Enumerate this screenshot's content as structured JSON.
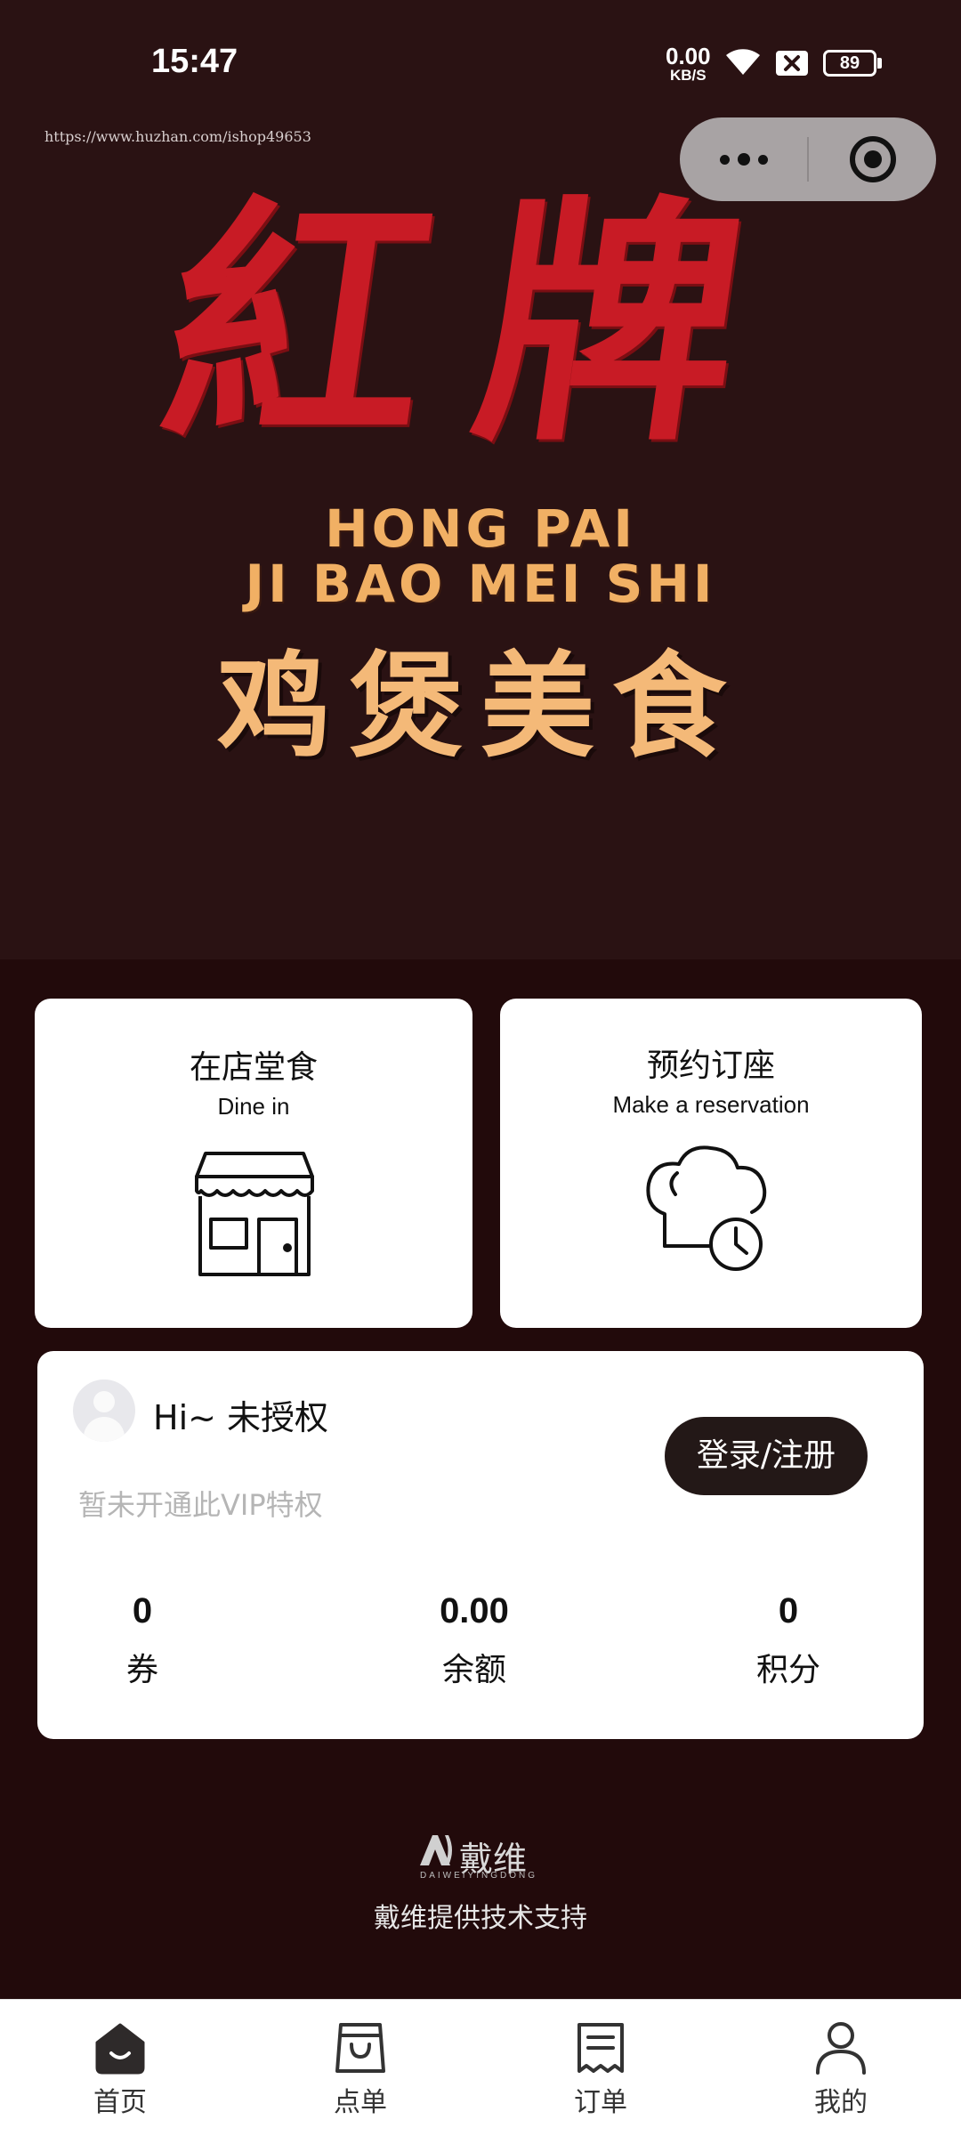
{
  "status_bar": {
    "time": "15:47",
    "net_speed_value": "0.00",
    "net_speed_unit": "KB/S",
    "battery": "89",
    "icons": [
      "wifi-icon",
      "sim-x-icon",
      "battery-icon"
    ]
  },
  "banner": {
    "url": "https://www.huzhan.com/ishop49653",
    "brand_cn": "紅牌",
    "brand_en_line1": "HONG PAI",
    "brand_en_line2": "JI BAO MEI SHI",
    "brand_sub": "鸡煲美食",
    "colors": {
      "brand_red": "#c81b25",
      "brand_gold": "#f1b064"
    }
  },
  "capsule": {
    "icons": [
      "more-icon",
      "close-miniprogram-icon"
    ]
  },
  "cards": {
    "dine_in": {
      "title": "在店堂食",
      "subtitle": "Dine in",
      "icon": "storefront-icon"
    },
    "reserve": {
      "title": "预约订座",
      "subtitle": "Make a reservation",
      "icon": "chef-hat-clock-icon"
    }
  },
  "member": {
    "greeting": "Hi~ 未授权",
    "login_button": "登录/注册",
    "vip_note": "暂未开通此VIP特权",
    "stats": [
      {
        "value": "0",
        "label": "券"
      },
      {
        "value": "0.00",
        "label": "余额"
      },
      {
        "value": "0",
        "label": "积分"
      }
    ]
  },
  "credit": {
    "logo_name": "戴维",
    "logo_en": "DAIWEIYINGDONG",
    "text": "戴维提供技术支持"
  },
  "tabbar": [
    {
      "label": "首页",
      "icon": "home-icon",
      "active": true
    },
    {
      "label": "点单",
      "icon": "shopping-bag-icon",
      "active": false
    },
    {
      "label": "订单",
      "icon": "receipt-icon",
      "active": false
    },
    {
      "label": "我的",
      "icon": "user-icon",
      "active": false
    }
  ]
}
